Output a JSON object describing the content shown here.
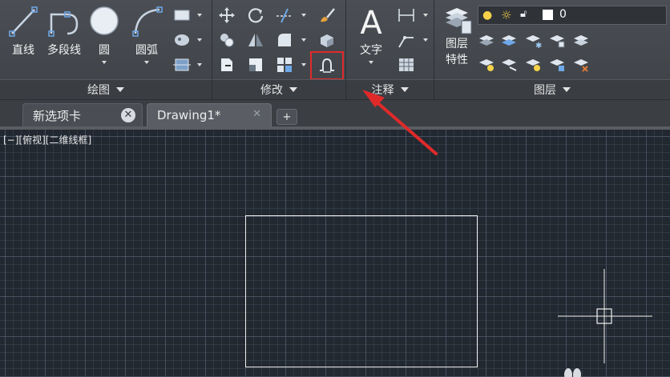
{
  "ribbon": {
    "draw_panel": {
      "title": "绘图",
      "tools": {
        "line": "直线",
        "polyline": "多段线",
        "circle": "圆",
        "arc": "圆弧"
      }
    },
    "modify_panel": {
      "title": "修改"
    },
    "annotation_panel": {
      "title": "注释",
      "tools": {
        "text": "文字"
      }
    },
    "layers_panel": {
      "title": "图层",
      "tools": {
        "properties_line1": "图层",
        "properties_line2": "特性"
      },
      "current_layer": "0"
    }
  },
  "tabs": [
    {
      "label": "新选项卡"
    },
    {
      "label": "Drawing1*"
    }
  ],
  "viewport": {
    "label": "[−][俯视][二维线框]"
  },
  "colors": {
    "highlight": "#e02a2a",
    "canvas_bg": "#212830",
    "ribbon_bg": "#45494e"
  }
}
